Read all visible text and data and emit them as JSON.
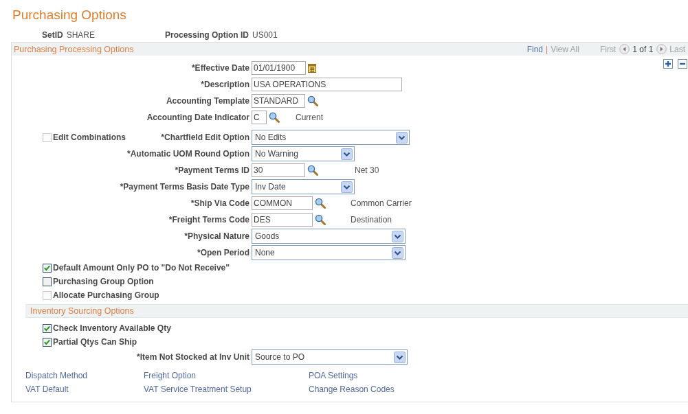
{
  "page": {
    "title": "Purchasing Options"
  },
  "keys": [
    {
      "label": "SetID",
      "value": "SHARE"
    },
    {
      "label": "Processing Option ID",
      "value": "US001"
    }
  ],
  "section": {
    "title": "Purchasing Processing Options",
    "nav": {
      "find": "Find",
      "separator": "|",
      "view_all": "View All",
      "first": "First",
      "position": "1 of 1",
      "last": "Last"
    },
    "fields": [
      {
        "kind": "date",
        "label": "*Effective Date",
        "value": "01/01/1900"
      },
      {
        "kind": "text",
        "label": "*Description",
        "value": "USA OPERATIONS"
      },
      {
        "kind": "lookup",
        "label": "Accounting Template",
        "value": "STANDARD"
      },
      {
        "kind": "lookup",
        "label": "Accounting Date Indicator",
        "value": "C",
        "description": "Current"
      },
      {
        "kind": "select",
        "label": "*Chartfield Edit Option",
        "value": "No Edits",
        "side_checkbox": {
          "label": "Edit Combinations",
          "checked": false,
          "disabled": true
        }
      },
      {
        "kind": "select",
        "label": "*Automatic UOM Round Option",
        "value": "No Warning"
      },
      {
        "kind": "lookup",
        "label": "*Payment Terms ID",
        "value": "30",
        "description": "Net 30"
      },
      {
        "kind": "select",
        "label": "*Payment Terms Basis Date Type",
        "value": "Inv Date"
      },
      {
        "kind": "lookup",
        "label": "*Ship Via Code",
        "value": "COMMON",
        "description": "Common Carrier"
      },
      {
        "kind": "lookup",
        "label": "*Freight Terms Code",
        "value": "DES",
        "description": "Destination"
      },
      {
        "kind": "select",
        "label": "*Physical Nature",
        "value": "Goods"
      },
      {
        "kind": "select",
        "label": "*Open Period",
        "value": "None"
      }
    ],
    "checkboxes": [
      {
        "label": "Default Amount Only PO to \"Do Not Receive\"",
        "checked": true,
        "disabled": false
      },
      {
        "label": "Purchasing Group Option",
        "checked": false,
        "disabled": false
      },
      {
        "label": "Allocate Purchasing Group",
        "checked": false,
        "disabled": true
      }
    ],
    "inventory": {
      "title": "Inventory Sourcing Options",
      "checkboxes": [
        {
          "label": "Check Inventory Available Qty",
          "checked": true,
          "disabled": false
        },
        {
          "label": "Partial Qtys Can Ship",
          "checked": true,
          "disabled": false
        }
      ],
      "fields": [
        {
          "kind": "select",
          "label": "*Item Not Stocked at Inv Unit",
          "value": "Source to PO"
        }
      ]
    },
    "links": [
      [
        "Dispatch Method",
        "Freight Option",
        "POA Settings"
      ],
      [
        "VAT Default",
        "VAT Service Treatment Setup",
        "Change Reason Codes"
      ]
    ]
  }
}
